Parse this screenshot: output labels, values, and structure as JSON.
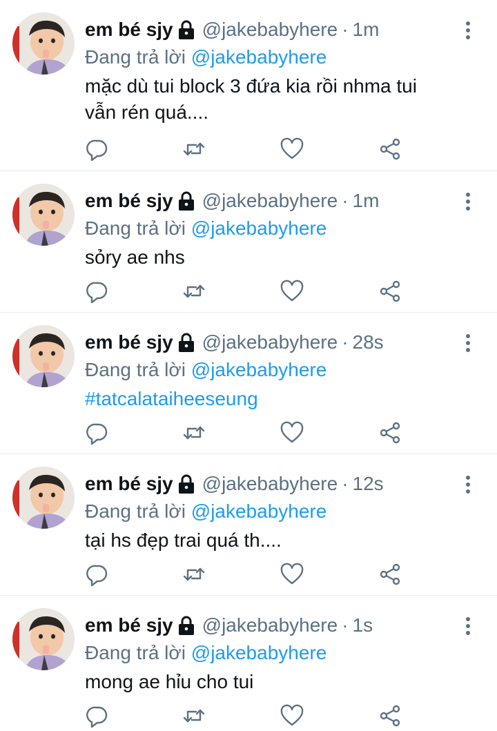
{
  "colors": {
    "name": "#0f1419",
    "muted": "#5b7083",
    "link": "#1d9bf0",
    "divider": "#e6ecf0"
  },
  "icons": [
    "lock-icon",
    "more-options-icon",
    "reply-icon",
    "retweet-icon",
    "like-icon",
    "share-icon"
  ],
  "tweets": [
    {
      "name": "em bé sjy",
      "handle": "@jakebabyhere",
      "separator": "·",
      "time": "1m",
      "replying_prefix": "Đang trả lời",
      "replying_to": "@jakebabyhere",
      "text_line1": "mặc dù tui block 3 đứa kia rồi nhma tui",
      "text_line2": "vẫn rén quá...."
    },
    {
      "name": "em bé sjy",
      "handle": "@jakebabyhere",
      "separator": "·",
      "time": "1m",
      "replying_prefix": "Đang trả lời",
      "replying_to": "@jakebabyhere",
      "text": "sỏry ae nhs"
    },
    {
      "name": "em bé sjy",
      "handle": "@jakebabyhere",
      "separator": "·",
      "time": "28s",
      "replying_prefix": "Đang trả lời",
      "replying_to": "@jakebabyhere",
      "text": "#tatcalataiheeseung"
    },
    {
      "name": "em bé sjy",
      "handle": "@jakebabyhere",
      "separator": "·",
      "time": "12s",
      "replying_prefix": "Đang trả lời",
      "replying_to": "@jakebabyhere",
      "text": "tại hs đẹp trai quá th...."
    },
    {
      "name": "em bé sjy",
      "handle": "@jakebabyhere",
      "separator": "·",
      "time": "1s",
      "replying_prefix": "Đang trả lời",
      "replying_to": "@jakebabyhere",
      "text": "mong ae hỉu cho tui"
    }
  ]
}
